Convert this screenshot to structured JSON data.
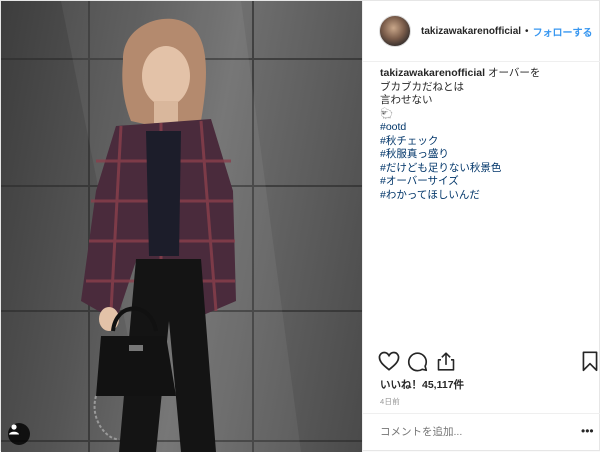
{
  "post": {
    "username": "takizawakarenofficial",
    "separator": "•",
    "follow_label": "フォローする"
  },
  "caption": {
    "username": "takizawakarenofficial",
    "lines": [
      "オーバーを",
      "ブカブカだねとは",
      "言わせない",
      "🐑"
    ],
    "hashtags": [
      "#ootd",
      "#秋チェック",
      "#秋服真っ盛り",
      "#だけども足りない秋景色",
      "#オーバーサイズ",
      "#わかってほしいんだ"
    ]
  },
  "stats": {
    "likes": "いいね！45,117件",
    "time": "4日前"
  },
  "comment": {
    "placeholder": "コメントを追加..."
  },
  "icons": [
    "heart-icon",
    "comment-icon",
    "share-icon",
    "bookmark-icon",
    "user-tag-icon",
    "more-icon"
  ]
}
